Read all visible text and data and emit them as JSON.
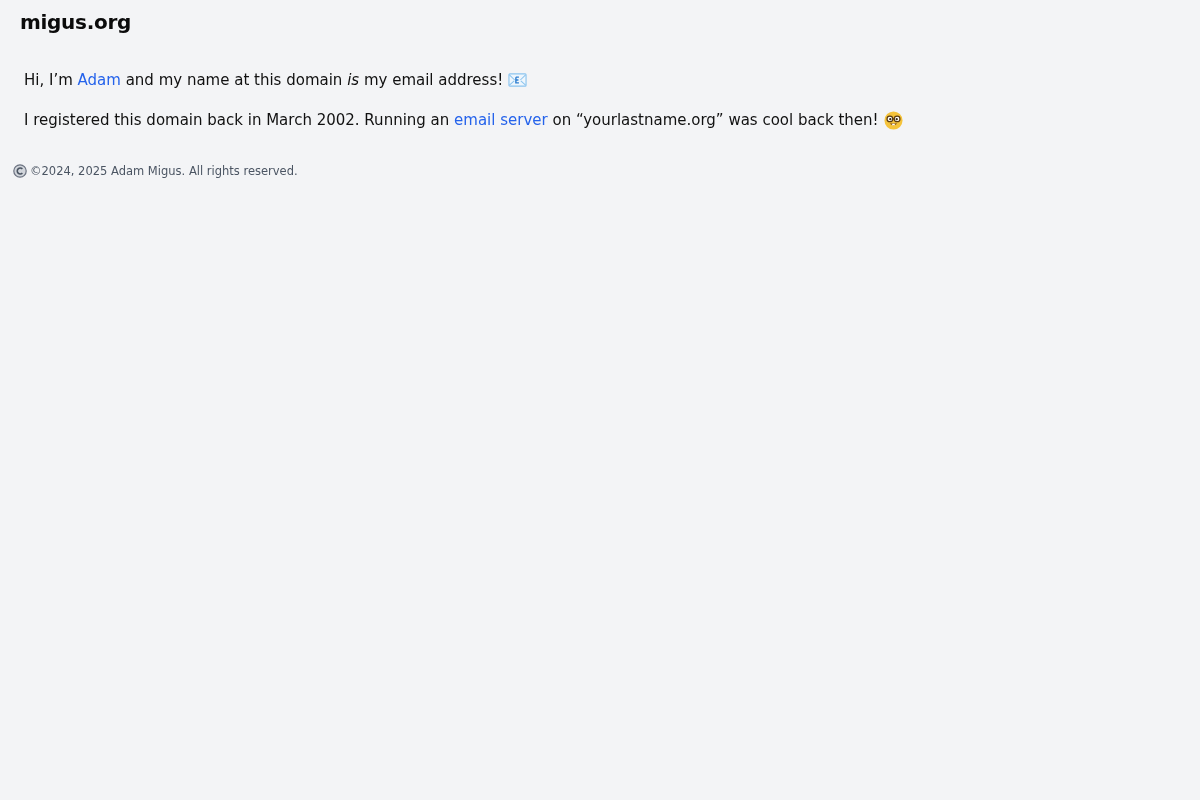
{
  "header": {
    "title": "migus.org"
  },
  "paragraphs": [
    {
      "parts": [
        {
          "kind": "text",
          "text": "Hi, I’m "
        },
        {
          "kind": "link",
          "text": "Adam"
        },
        {
          "kind": "text",
          "text": " and my name at this domain *is* my email address!"
        }
      ]
    },
    {
      "parts": [
        {
          "kind": "text",
          "text": "I registered this domain back in March 2002. Running an "
        },
        {
          "kind": "link",
          "text": "email server"
        },
        {
          "kind": "text",
          "text": " on “yourlastname.org” was cool back then!"
        }
      ]
    }
  ],
  "footer": {
    "text": "©2024, 2025 Adam Migus. All rights reserved."
  }
}
